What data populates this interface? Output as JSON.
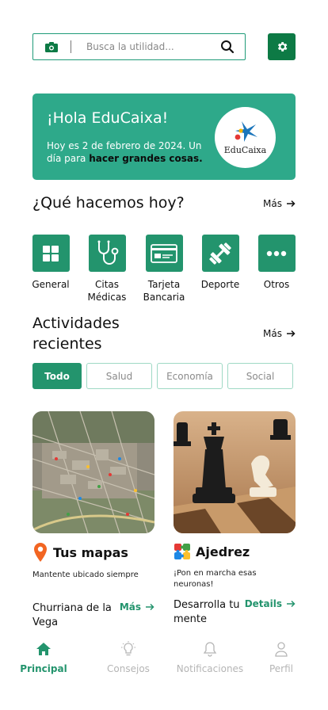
{
  "search": {
    "placeholder": "Busca la utilidad..."
  },
  "banner": {
    "greeting": "¡Hola EduCaixa!",
    "message_plain": "Hoy es 2 de febrero de 2024. Un día para ",
    "message_bold": "hacer grandes cosas.",
    "logo_text": "EduCaixa"
  },
  "today": {
    "heading": "¿Qué hacemos hoy?",
    "more_label": "Más",
    "categories": [
      {
        "label": "General",
        "icon": "grid-icon"
      },
      {
        "label": "Citas Médicas",
        "icon": "stethoscope-icon"
      },
      {
        "label": "Tarjeta Bancaria",
        "icon": "credit-card-icon"
      },
      {
        "label": "Deporte",
        "icon": "dumbbell-icon"
      },
      {
        "label": "Otros",
        "icon": "more-dots-icon"
      }
    ]
  },
  "recent": {
    "heading": "Actividades recientes",
    "more_label": "Más",
    "tabs": [
      "Todo",
      "Salud",
      "Economía",
      "Social"
    ],
    "active_tab": "Todo",
    "cards": [
      {
        "title": "Tus mapas",
        "icon": "map-pin-icon",
        "description": "Mantente ubicado siempre",
        "name": "Churriana de la Vega",
        "link": "Más"
      },
      {
        "title": "Ajedrez",
        "icon": "puzzle-icon",
        "description": "¡Pon en marcha esas neuronas!",
        "name": "Desarrolla tu mente",
        "link": "Details"
      }
    ]
  },
  "nav": {
    "items": [
      {
        "label": "Principal",
        "icon": "home-icon",
        "active": true
      },
      {
        "label": "Consejos",
        "icon": "lightbulb-icon",
        "active": false
      },
      {
        "label": "Notificaciones",
        "icon": "bell-icon",
        "active": false
      },
      {
        "label": "Perfil",
        "icon": "user-icon",
        "active": false
      }
    ]
  },
  "colors": {
    "accent": "#23946d",
    "banner": "#2ea98a",
    "settings": "#0d7a45",
    "inactive": "#b5b5b5"
  }
}
